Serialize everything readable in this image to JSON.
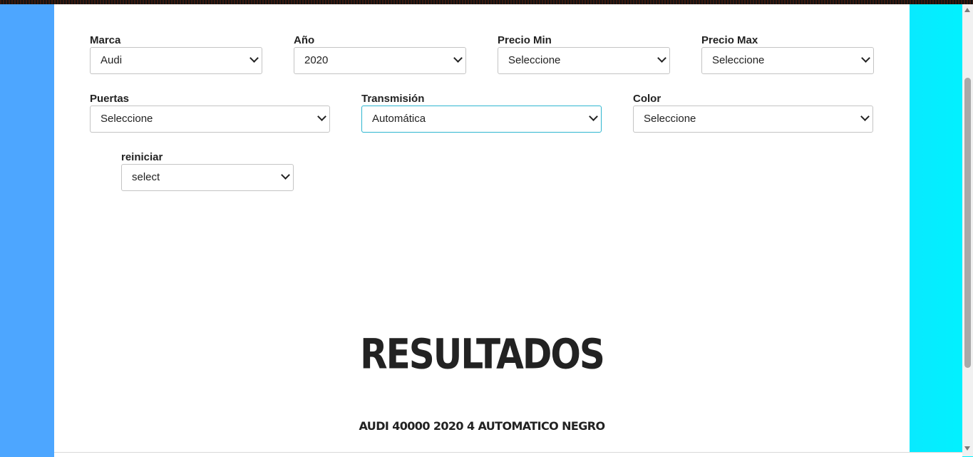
{
  "filters": {
    "marca": {
      "label": "Marca",
      "value": "Audi"
    },
    "anio": {
      "label": "Año",
      "value": "2020"
    },
    "precio_min": {
      "label": "Precio Min",
      "value": "Seleccione"
    },
    "precio_max": {
      "label": "Precio Max",
      "value": "Seleccione"
    },
    "puertas": {
      "label": "Puertas",
      "value": "Seleccione"
    },
    "transmision": {
      "label": "Transmisión",
      "value": "Automática"
    },
    "color": {
      "label": "Color",
      "value": "Seleccione"
    },
    "reiniciar": {
      "label": "reiniciar",
      "value": "select"
    }
  },
  "results": {
    "title": "RESULTADOS",
    "items": [
      "AUDI 40000 2020 4 AUTOMATICO NEGRO"
    ]
  },
  "icons": {
    "select_arrow": "chevron-down-icon"
  },
  "colors": {
    "focus_border": "#2fb6d0",
    "bg_left": "#4da6ff",
    "bg_right": "#00f2ff"
  }
}
